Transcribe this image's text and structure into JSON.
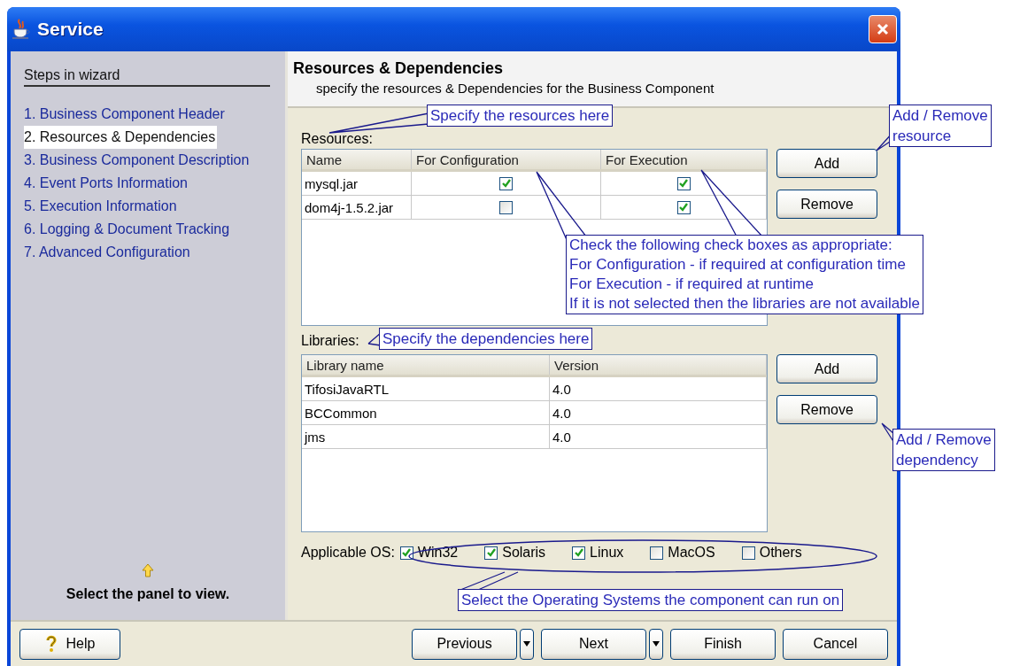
{
  "window": {
    "title": "Service"
  },
  "sidebar": {
    "heading": "Steps in wizard",
    "steps": [
      {
        "label": "1. Business Component Header",
        "selected": false
      },
      {
        "label": "2. Resources & Dependencies",
        "selected": true
      },
      {
        "label": "3. Business Component Description",
        "selected": false
      },
      {
        "label": "4. Event Ports Information",
        "selected": false
      },
      {
        "label": "5. Execution Information",
        "selected": false
      },
      {
        "label": "6. Logging & Document Tracking",
        "selected": false
      },
      {
        "label": "7. Advanced Configuration",
        "selected": false
      }
    ],
    "hint": "Select the panel to view."
  },
  "panel": {
    "title": "Resources & Dependencies",
    "subtitle": "specify the resources & Dependencies for the Business Component"
  },
  "resources": {
    "label": "Resources:",
    "columns": [
      "Name",
      "For Configuration",
      "For Execution"
    ],
    "rows": [
      {
        "name": "mysql.jar",
        "for_configuration": true,
        "for_execution": true
      },
      {
        "name": "dom4j-1.5.2.jar",
        "for_configuration": false,
        "for_execution": true
      }
    ],
    "buttons": [
      "Add",
      "Remove"
    ]
  },
  "libraries": {
    "label": "Libraries:",
    "columns": [
      "Library name",
      "Version"
    ],
    "rows": [
      {
        "name": "TifosiJavaRTL",
        "version": "4.0"
      },
      {
        "name": "BCCommon",
        "version": "4.0"
      },
      {
        "name": "jms",
        "version": "4.0"
      }
    ],
    "buttons": [
      "Add",
      "Remove"
    ]
  },
  "applicable_os": {
    "label": "Applicable OS:",
    "options": [
      {
        "label": "Win32",
        "checked": true
      },
      {
        "label": "Solaris",
        "checked": true
      },
      {
        "label": "Linux",
        "checked": true
      },
      {
        "label": "MacOS",
        "checked": false
      },
      {
        "label": "Others",
        "checked": false
      }
    ]
  },
  "footer": {
    "buttons": [
      {
        "label": "Help",
        "kind": "help"
      },
      {
        "label": "Previous",
        "kind": "split"
      },
      {
        "label": "Next",
        "kind": "split"
      },
      {
        "label": "Finish",
        "kind": "plain"
      },
      {
        "label": "Cancel",
        "kind": "plain"
      }
    ]
  },
  "callouts": [
    {
      "lines": [
        "Specify the resources here"
      ]
    },
    {
      "lines": [
        "Add / Remove",
        "resource"
      ]
    },
    {
      "lines": [
        "Check the following check boxes as appropriate:",
        "For Configuration - if required at configuration time",
        "For Execution - if required at runtime",
        "If it is not selected then the libraries are not available"
      ]
    },
    {
      "lines": [
        "Specify the dependencies here"
      ]
    },
    {
      "lines": [
        "Add / Remove",
        "dependency"
      ]
    },
    {
      "lines": [
        "Select the Operating Systems the component can run on"
      ]
    }
  ]
}
